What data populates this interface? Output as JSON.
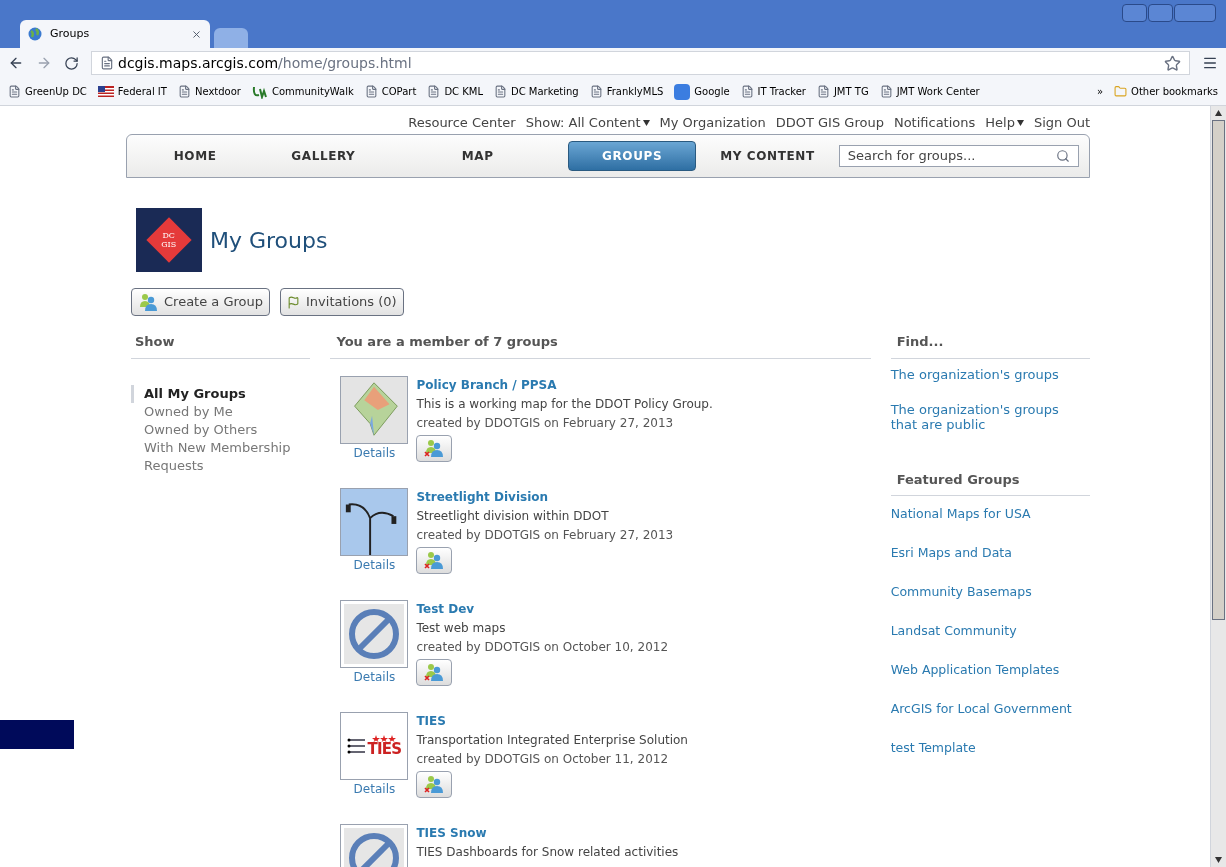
{
  "browser": {
    "tabs": [
      {
        "title": "Groups",
        "selected": true
      },
      {
        "selected": false
      }
    ],
    "url_host": "dcgis.maps.arcgis.com",
    "url_path": "/home/groups.html",
    "bookmarks": [
      {
        "label": "GreenUp DC",
        "kind": "page"
      },
      {
        "label": "Federal IT",
        "kind": "flag"
      },
      {
        "label": "Nextdoor",
        "kind": "page"
      },
      {
        "label": "CommunityWalk",
        "kind": "cw"
      },
      {
        "label": "COPart",
        "kind": "page"
      },
      {
        "label": "DC KML",
        "kind": "page"
      },
      {
        "label": "DC Marketing",
        "kind": "page"
      },
      {
        "label": "FranklyMLS",
        "kind": "page"
      },
      {
        "label": "Google",
        "kind": "google"
      },
      {
        "label": "IT Tracker",
        "kind": "page"
      },
      {
        "label": "JMT TG",
        "kind": "page"
      },
      {
        "label": "JMT Work Center",
        "kind": "page"
      }
    ],
    "overflow": "»",
    "other_bookmarks": "Other bookmarks"
  },
  "top_links": [
    {
      "label": "Resource Center",
      "dropdown": false
    },
    {
      "label": "Show: All Content",
      "dropdown": true
    },
    {
      "label": "My Organization",
      "dropdown": false
    },
    {
      "label": "DDOT GIS Group",
      "dropdown": false
    },
    {
      "label": "Notifications",
      "dropdown": false
    },
    {
      "label": "Help",
      "dropdown": true
    },
    {
      "label": "Sign Out",
      "dropdown": false
    }
  ],
  "nav": [
    {
      "label": "HOME",
      "selected": false
    },
    {
      "label": "GALLERY",
      "selected": false
    },
    {
      "label": "MAP",
      "selected": false
    },
    {
      "label": "GROUPS",
      "selected": true
    },
    {
      "label": "MY CONTENT",
      "selected": false
    }
  ],
  "search": {
    "placeholder": "Search for groups..."
  },
  "header": {
    "logo_text": [
      "DC",
      "GIS"
    ],
    "title": "My Groups"
  },
  "actions": [
    {
      "label": "Create a Group",
      "kind": "people"
    },
    {
      "label": "Invitations (0)",
      "kind": "flag"
    }
  ],
  "show": {
    "heading": "Show",
    "items": [
      {
        "label": "All My Groups",
        "selected": true
      },
      {
        "label": "Owned by Me",
        "selected": false
      },
      {
        "label": "Owned by Others",
        "selected": false
      },
      {
        "label": "With New Membership Requests",
        "selected": false
      }
    ]
  },
  "groups": {
    "heading": "You are a member of 7 groups",
    "items": [
      {
        "title": "Policy Branch / PPSA",
        "description": "This is a working map for the DDOT Policy Group.",
        "created": "created by DDOTGIS on February 27, 2013",
        "details": "Details",
        "kind": "map"
      },
      {
        "title": "Streetlight Division",
        "description": "Streetlight division within DDOT",
        "created": "created by DDOTGIS on February 27, 2013",
        "details": "Details",
        "kind": "photo"
      },
      {
        "title": "Test Dev",
        "description": "Test web maps",
        "created": "created by DDOTGIS on October 10, 2012",
        "details": "Details",
        "kind": "blank"
      },
      {
        "title": "TIES",
        "description": "Transportation Integrated Enterprise Solution",
        "created": "created by DDOTGIS on October 11, 2012",
        "details": "Details",
        "kind": "logo",
        "logo_text": "TIES"
      },
      {
        "title": "TIES Snow",
        "description": "TIES Dashboards for Snow related activities",
        "kind": "blank"
      }
    ]
  },
  "find": {
    "heading": "Find...",
    "links": [
      "The organization's groups",
      "The organization's groups that are public"
    ]
  },
  "featured": {
    "heading": "Featured Groups",
    "links": [
      "National Maps for USA",
      "Esri Maps and Data",
      "Community Basemaps",
      "Landsat Community",
      "Web Application Templates",
      "ArcGIS for Local Government",
      "test Template"
    ]
  }
}
